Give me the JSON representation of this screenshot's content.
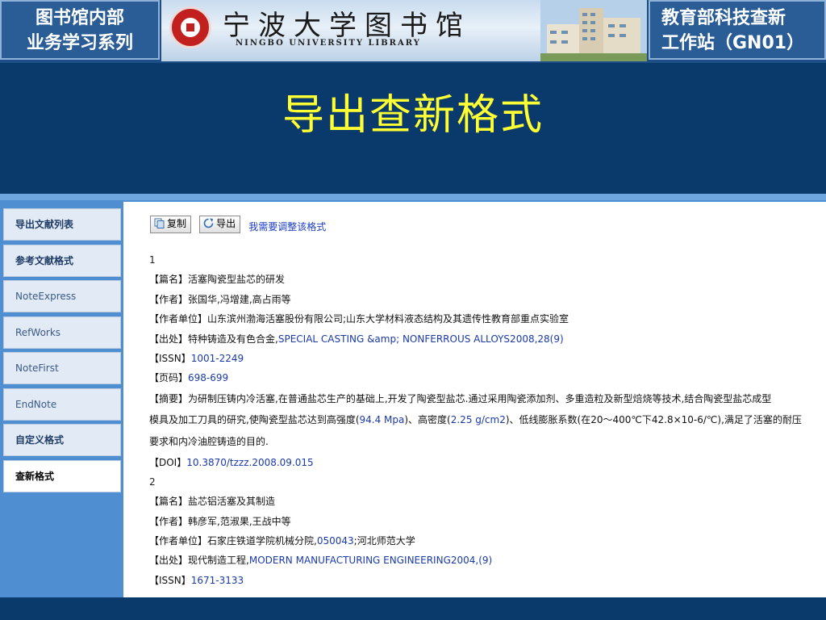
{
  "banner": {
    "left_line1": "图书馆内部",
    "left_line2": "业务学习系列",
    "library_cn": "宁波大学图书馆",
    "library_en": "NINGBO UNIVERSITY LIBRARY",
    "right_line1": "教育部科技查新",
    "right_line2": "工作站（GN01）"
  },
  "title": "导出查新格式",
  "sidebar": {
    "items": [
      {
        "label": "导出文献列表"
      },
      {
        "label": "参考文献格式"
      },
      {
        "label": "NoteExpress"
      },
      {
        "label": "RefWorks"
      },
      {
        "label": "NoteFirst"
      },
      {
        "label": "EndNote"
      },
      {
        "label": "自定义格式"
      },
      {
        "label": "查新格式"
      }
    ],
    "active": "查新格式"
  },
  "toolbar": {
    "copy_label": "复制",
    "export_label": "导出",
    "adjust_link": "我需要调整该格式"
  },
  "records": [
    {
      "number": "1",
      "title_label": "【篇名】",
      "title": "活塞陶瓷型盐芯的研发",
      "author_label": "【作者】",
      "author": "张国华,冯增建,高占雨等",
      "org_label": "【作者单位】",
      "org": "山东滨州渤海活塞股份有限公司;山东大学材料液态结构及其遗传性教育部重点实验室",
      "source_label": "【出处】",
      "source_cn": "特种铸造及有色合金,",
      "source_en": "SPECIAL CASTING &amp; NONFERROUS ALLOYS2008,28(9)",
      "issn_label": "【ISSN】",
      "issn": "1001-2249",
      "pages_label": "【页码】",
      "pages": "698-699",
      "abstract_label": "【摘要】",
      "abstract_line1": "为研制压铸内冷活塞,在普通盐芯生产的基础上,开发了陶瓷型盐芯.通过采用陶瓷添加剂、多重造粒及新型焙烧等技术,结合陶瓷型盐芯成型",
      "abstract_line2a": "模具及加工刀具的研究,使陶瓷型盐芯达到高强度(",
      "abstract_line2b": "94.4 Mpa",
      "abstract_line2c": ")、高密度(",
      "abstract_line2d": "2.25 g/cm2",
      "abstract_line2e": ")、低线膨胀系数(在20～400℃下42.8×10-6/℃),满足了活塞的耐压",
      "abstract_line3": "要求和内冷油腔铸造的目的.",
      "doi_label": "【DOI】",
      "doi": "10.3870/tzzz.2008.09.015"
    },
    {
      "number": "2",
      "title_label": "【篇名】",
      "title": "盐芯铝活塞及其制造",
      "author_label": "【作者】",
      "author": "韩彦军,范淑果,王战中等",
      "org_label": "【作者单位】",
      "org_cn": "石家庄铁道学院机械分院,",
      "org_num": "050043",
      "org_cn2": ";河北师范大学",
      "source_label": "【出处】",
      "source_cn": "现代制造工程,",
      "source_en": "MODERN MANUFACTURING ENGINEERING2004,(9)",
      "issn_label": "【ISSN】",
      "issn": "1671-3133"
    }
  ],
  "colors": {
    "background": "#0a3a6b",
    "title": "#ffff33",
    "panel": "#4f8ed0",
    "link": "#1a3cc4"
  }
}
